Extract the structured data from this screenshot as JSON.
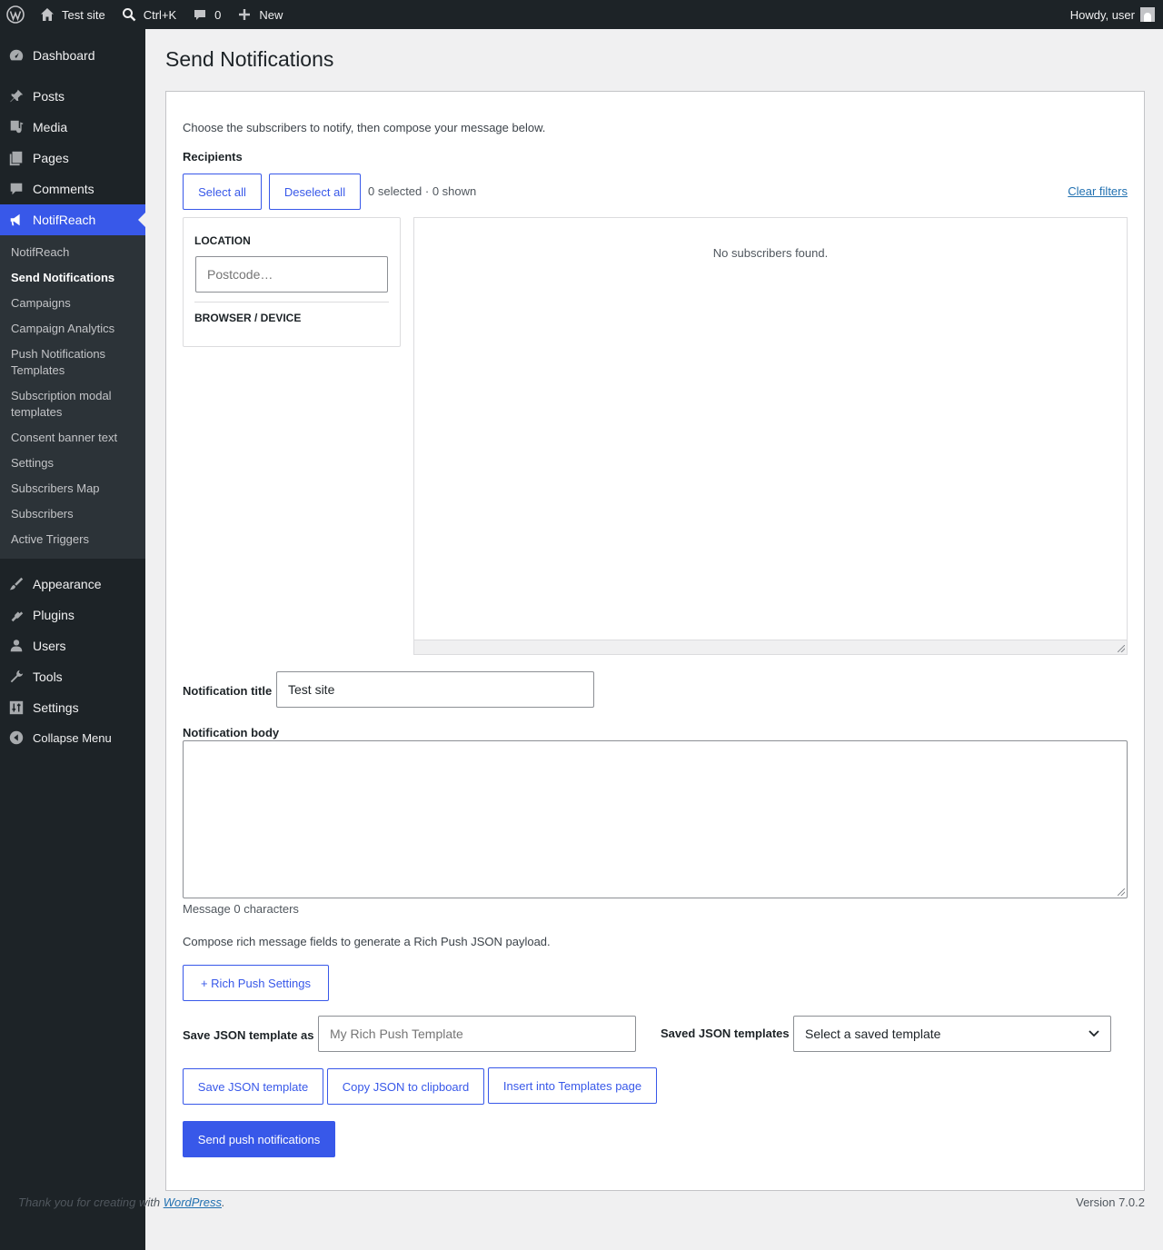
{
  "adminbar": {
    "site_name": "Test site",
    "search_shortcut": "Ctrl+K",
    "comments_count": "0",
    "new_label": "New",
    "howdy": "Howdy, user"
  },
  "sidebar": {
    "items": [
      {
        "label": "Dashboard"
      },
      {
        "label": "Posts"
      },
      {
        "label": "Media"
      },
      {
        "label": "Pages"
      },
      {
        "label": "Comments"
      },
      {
        "label": "NotifReach"
      },
      {
        "label": "Appearance"
      },
      {
        "label": "Plugins"
      },
      {
        "label": "Users"
      },
      {
        "label": "Tools"
      },
      {
        "label": "Settings"
      },
      {
        "label": "Collapse Menu"
      }
    ],
    "submenu": [
      {
        "label": "NotifReach"
      },
      {
        "label": "Send Notifications"
      },
      {
        "label": "Campaigns"
      },
      {
        "label": "Campaign Analytics"
      },
      {
        "label": "Push Notifications Templates"
      },
      {
        "label": "Subscription modal templates"
      },
      {
        "label": "Consent banner text"
      },
      {
        "label": "Settings"
      },
      {
        "label": "Subscribers Map"
      },
      {
        "label": "Subscribers"
      },
      {
        "label": "Active Triggers"
      }
    ]
  },
  "page": {
    "title": "Send Notifications",
    "intro": "Choose the subscribers to notify, then compose your message below.",
    "recipients_label": "Recipients",
    "select_all": "Select all",
    "deselect_all": "Deselect all",
    "selection_status": "0 selected · 0 shown",
    "clear_filters": "Clear filters",
    "filters": {
      "location_heading": "LOCATION",
      "postcode_placeholder": "Postcode…",
      "browser_heading": "BROWSER / DEVICE"
    },
    "list_empty": "No subscribers found.",
    "title_label": "Notification title",
    "title_value": "Test site",
    "body_label": "Notification body",
    "body_value": "",
    "char_count": "Message 0 characters",
    "rich_intro": "Compose rich message fields to generate a Rich Push JSON payload.",
    "rich_settings_button": "+ Rich Push Settings",
    "save_as_label": "Save JSON template as",
    "save_as_placeholder": "My Rich Push Template",
    "saved_templates_label": "Saved JSON templates",
    "saved_templates_selected": "Select a saved template",
    "save_json_button": "Save JSON template",
    "copy_json_button": "Copy JSON to clipboard",
    "insert_button": "Insert into Templates page",
    "send_button": "Send push notifications"
  },
  "footer": {
    "thanks_prefix": "Thank you for creating with ",
    "wordpress_link": "WordPress",
    "thanks_suffix": ".",
    "version": "Version 7.0.2"
  }
}
